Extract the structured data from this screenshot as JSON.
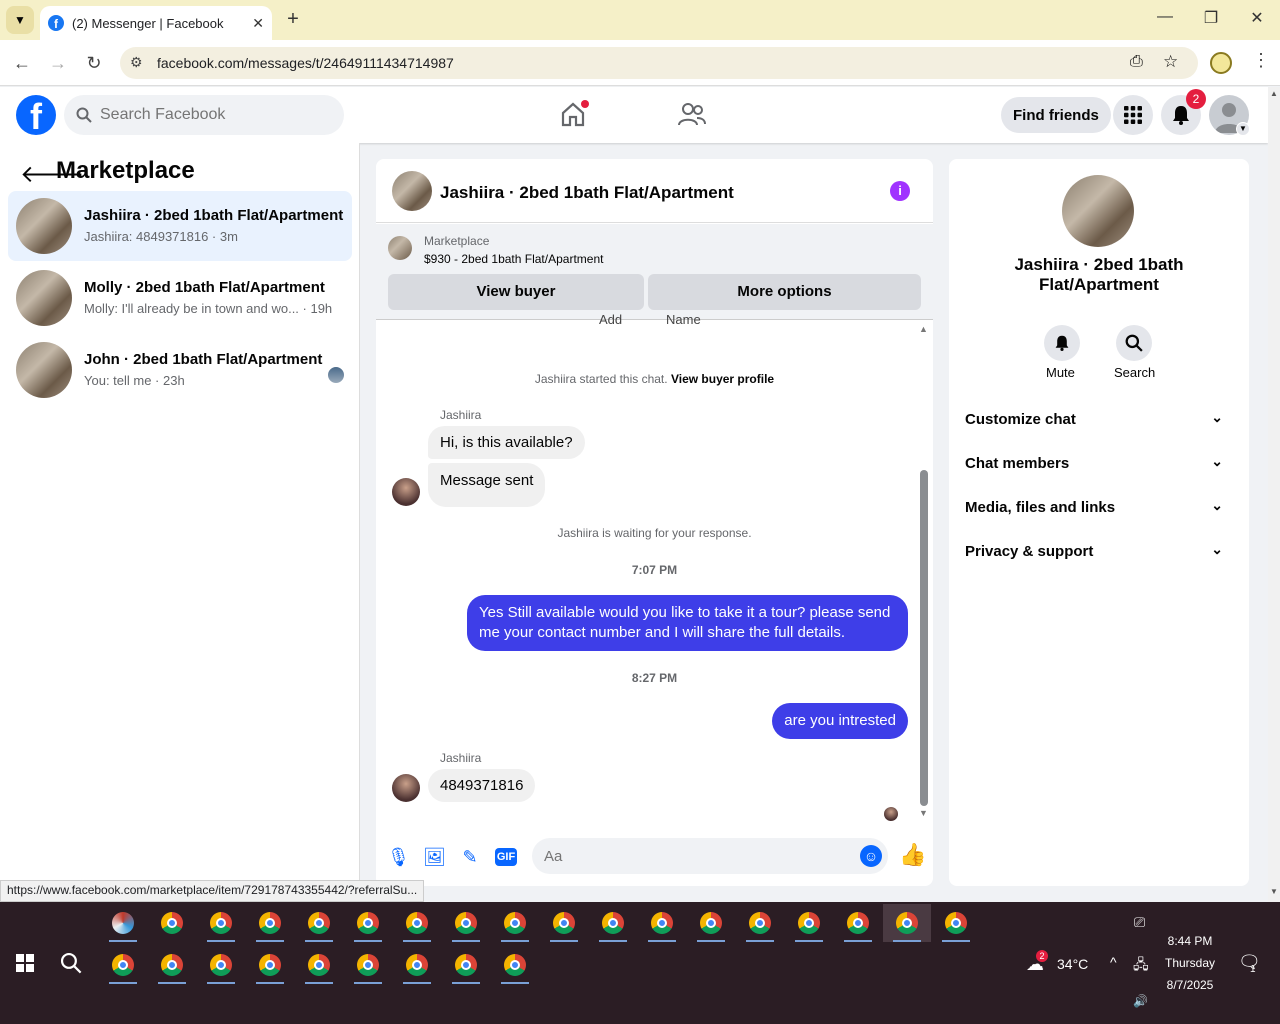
{
  "browser": {
    "tab_title": "(2) Messenger | Facebook",
    "url": "facebook.com/messages/t/24649111434714987",
    "status_url": "https://www.facebook.com/marketplace/item/729178743355442/?referralSu..."
  },
  "fb": {
    "search_placeholder": "Search Facebook",
    "find_friends": "Find friends",
    "notif_count": "2"
  },
  "left": {
    "title": "Marketplace",
    "conversations": [
      {
        "name": "Jashiira · 2bed 1bath Flat/Apartment",
        "preview": "Jashiira: 4849371816 · 3m"
      },
      {
        "name": "Molly · 2bed 1bath Flat/Apartment",
        "preview": "Molly: I'll already be in town and wo... · 19h"
      },
      {
        "name": "John · 2bed 1bath Flat/Apartment",
        "preview": "You: tell me · 23h"
      }
    ]
  },
  "chat": {
    "title": "Jashiira · 2bed 1bath Flat/Apartment",
    "marketplace_label": "Marketplace",
    "item": "$930 - 2bed 1bath Flat/Apartment",
    "view_buyer": "View buyer",
    "more_options": "More options",
    "cut_labels": [
      "Add",
      "Name"
    ],
    "started": "Jashiira started this chat.",
    "view_buyer_profile": "View buyer profile",
    "sender1": "Jashiira",
    "msg1": "Hi, is this available?",
    "msg2": "Message sent",
    "waiting": "Jashiira is waiting for your response.",
    "time1": "7:07 PM",
    "out1": "Yes Still available would you like to take it a tour? please send me your contact number and I will share the full details.",
    "time2": "8:27 PM",
    "out2": "are you  intrested",
    "sender2": "Jashiira",
    "msg3": "4849371816",
    "input_placeholder": "Aa"
  },
  "right": {
    "name": "Jashiira · 2bed 1bath Flat/Apartment",
    "mute": "Mute",
    "search": "Search",
    "rows": [
      "Customize chat",
      "Chat members",
      "Media, files and links",
      "Privacy & support"
    ]
  },
  "taskbar": {
    "temp": "34°C",
    "weather_badge": "2",
    "time": "8:44 PM",
    "day": "Thursday",
    "date": "8/7/2025",
    "notif": "1"
  },
  "colors": {
    "fb_blue": "#0866ff",
    "outgoing_bubble": "#3e3ee8",
    "info_purple": "#a033ff",
    "badge_red": "#e41e3f"
  }
}
